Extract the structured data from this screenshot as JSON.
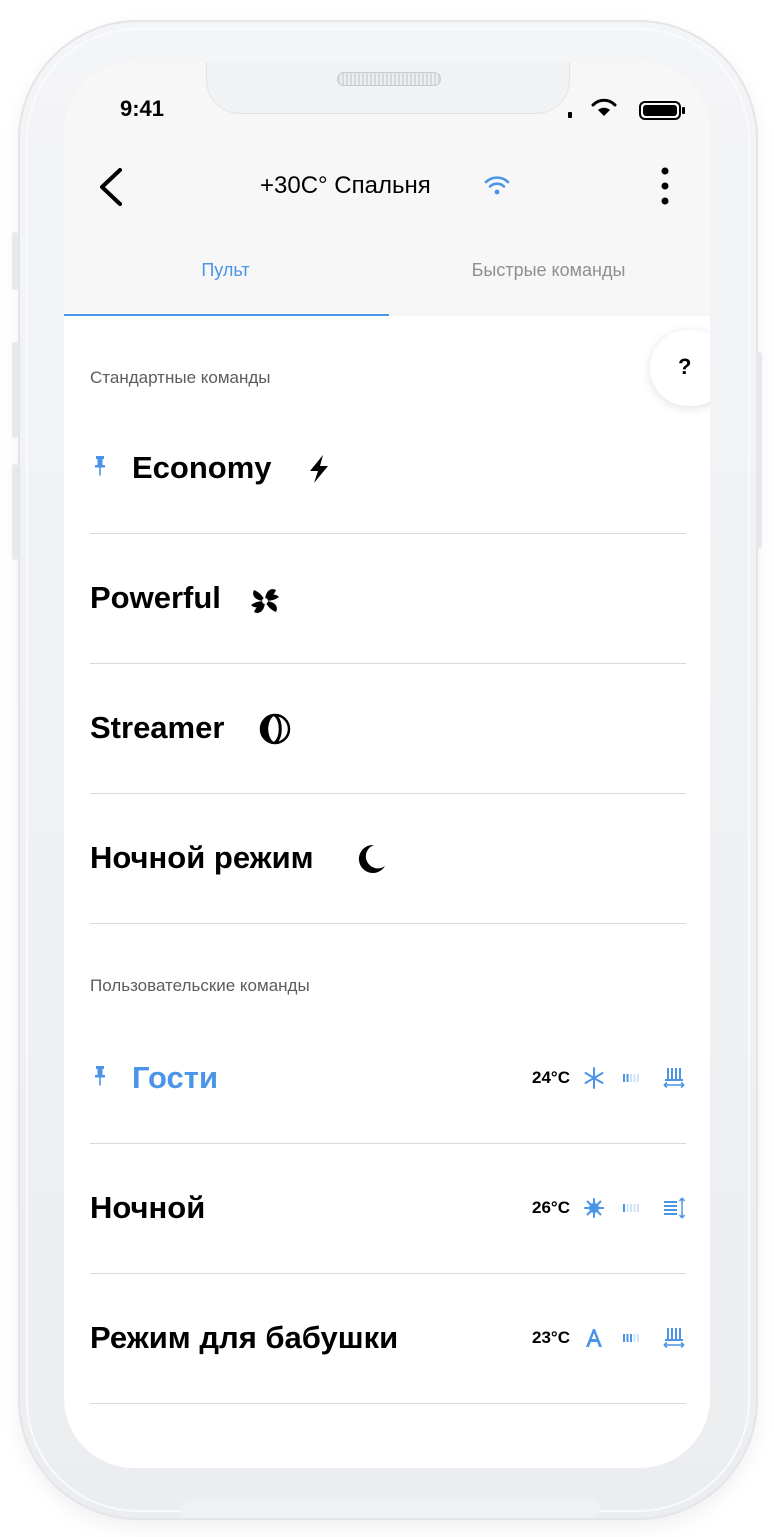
{
  "status_bar": {
    "time": "9:41"
  },
  "header": {
    "title": "+30С° Спальня"
  },
  "tabs": [
    {
      "label": "Пульт",
      "active": true
    },
    {
      "label": "Быстрые команды",
      "active": false
    }
  ],
  "help": {
    "label": "?"
  },
  "standard_section": {
    "label": "Стандартные команды",
    "items": [
      {
        "label": "Economy",
        "icon": "lightning-icon",
        "pinned": true
      },
      {
        "label": "Powerful",
        "icon": "fan-icon",
        "pinned": false
      },
      {
        "label": "Streamer",
        "icon": "streamer-icon",
        "pinned": false
      },
      {
        "label": "Ночной режим",
        "icon": "moon-icon",
        "pinned": false
      }
    ]
  },
  "user_section": {
    "label": "Пользовательские команды",
    "items": [
      {
        "label": "Гости",
        "temperature": "24°C",
        "mode_icon": "snowflake-icon",
        "fan_icon": "fan-speed-icon",
        "swing_icon": "swing-horizontal-icon",
        "pinned": true
      },
      {
        "label": "Ночной",
        "temperature": "26°C",
        "mode_icon": "sun-icon",
        "fan_icon": "fan-speed-icon",
        "swing_icon": "swing-vertical-icon",
        "pinned": false
      },
      {
        "label": "Режим для бабушки",
        "temperature": "23°C",
        "mode_icon": "auto-mode-icon",
        "fan_icon": "fan-speed-icon",
        "swing_icon": "swing-horizontal-icon",
        "pinned": false
      }
    ]
  },
  "colors": {
    "accent": "#4a95e8",
    "text": "#000000",
    "secondary_text": "#8e8f93",
    "divider": "#d9dadc"
  }
}
